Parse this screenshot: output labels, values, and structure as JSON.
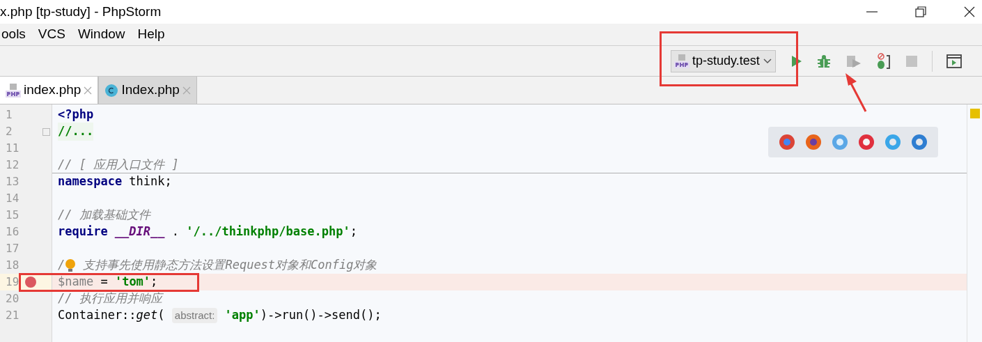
{
  "window": {
    "title": "x.php [tp-study] - PhpStorm"
  },
  "menu": [
    {
      "label": "ools"
    },
    {
      "label": "VCS"
    },
    {
      "label": "Window"
    },
    {
      "label": "Help"
    }
  ],
  "run_config": {
    "label": "tp-study.test"
  },
  "tabs": [
    {
      "label": "index.php",
      "kind": "php",
      "selected": true
    },
    {
      "label": "Index.php",
      "kind": "class",
      "selected": false
    }
  ],
  "lines": [
    {
      "number": "1",
      "breakpoint": false,
      "separator": false,
      "folded": false,
      "intention": false,
      "tokens": [
        {
          "kind": "keyword",
          "text": "<?php"
        }
      ]
    },
    {
      "number": "2",
      "breakpoint": false,
      "separator": false,
      "folded": true,
      "intention": false,
      "tokens": [
        {
          "kind": "fold",
          "text": "//..."
        }
      ]
    },
    {
      "number": "11",
      "breakpoint": false,
      "separator": false,
      "folded": false,
      "intention": false
    },
    {
      "number": "12",
      "breakpoint": false,
      "separator": true,
      "folded": false,
      "intention": false,
      "tokens": [
        {
          "kind": "comment",
          "text": "// [ 应用入口文件 ]"
        }
      ]
    },
    {
      "number": "13",
      "breakpoint": false,
      "separator": false,
      "folded": false,
      "intention": false,
      "tokens": [
        {
          "kind": "keyword",
          "text": "namespace"
        },
        {
          "kind": "plain",
          "text": " think;"
        }
      ]
    },
    {
      "number": "14",
      "breakpoint": false,
      "separator": false,
      "folded": false,
      "intention": false
    },
    {
      "number": "15",
      "breakpoint": false,
      "separator": false,
      "folded": false,
      "intention": false,
      "tokens": [
        {
          "kind": "comment",
          "text": "// 加载基础文件"
        }
      ]
    },
    {
      "number": "16",
      "breakpoint": false,
      "separator": false,
      "folded": false,
      "intention": false,
      "tokens": [
        {
          "kind": "keyword",
          "text": "require"
        },
        {
          "kind": "constant",
          "text": "__DIR__",
          "spaced": true
        },
        {
          "kind": "plain",
          "text": " . "
        },
        {
          "kind": "string",
          "text": "'/../thinkphp/base.php'"
        },
        {
          "kind": "plain",
          "text": ";"
        }
      ]
    },
    {
      "number": "17",
      "breakpoint": false,
      "separator": false,
      "folded": false,
      "intention": false
    },
    {
      "number": "18",
      "breakpoint": false,
      "separator": false,
      "folded": false,
      "intention": true,
      "tokens": [
        {
          "kind": "comment",
          "text": "/"
        },
        {
          "kind": "comment",
          "text": "支持事先使用静态方法设置Request对象和Config对象",
          "spaced": true
        }
      ]
    },
    {
      "number": "19",
      "breakpoint": true,
      "separator": false,
      "folded": false,
      "intention": false,
      "tokens": [
        {
          "kind": "variable",
          "text": "$name"
        },
        {
          "kind": "plain",
          "text": " = "
        },
        {
          "kind": "string",
          "text": "'tom'"
        },
        {
          "kind": "plain",
          "text": ";"
        }
      ]
    },
    {
      "number": "20",
      "breakpoint": false,
      "separator": false,
      "folded": false,
      "intention": false,
      "tokens": [
        {
          "kind": "comment",
          "text": "// 执行应用并响应"
        }
      ]
    },
    {
      "number": "21",
      "breakpoint": false,
      "separator": false,
      "folded": false,
      "intention": false,
      "tokens": [
        {
          "kind": "plain",
          "text": "Container::"
        },
        {
          "kind": "method",
          "text": "get"
        },
        {
          "kind": "plain",
          "text": "( "
        },
        {
          "kind": "hint",
          "text": "abstract:"
        },
        {
          "kind": "string",
          "text": "'app'",
          "spaced": true
        },
        {
          "kind": "plain",
          "text": ")->run()->send();"
        }
      ]
    }
  ]
}
